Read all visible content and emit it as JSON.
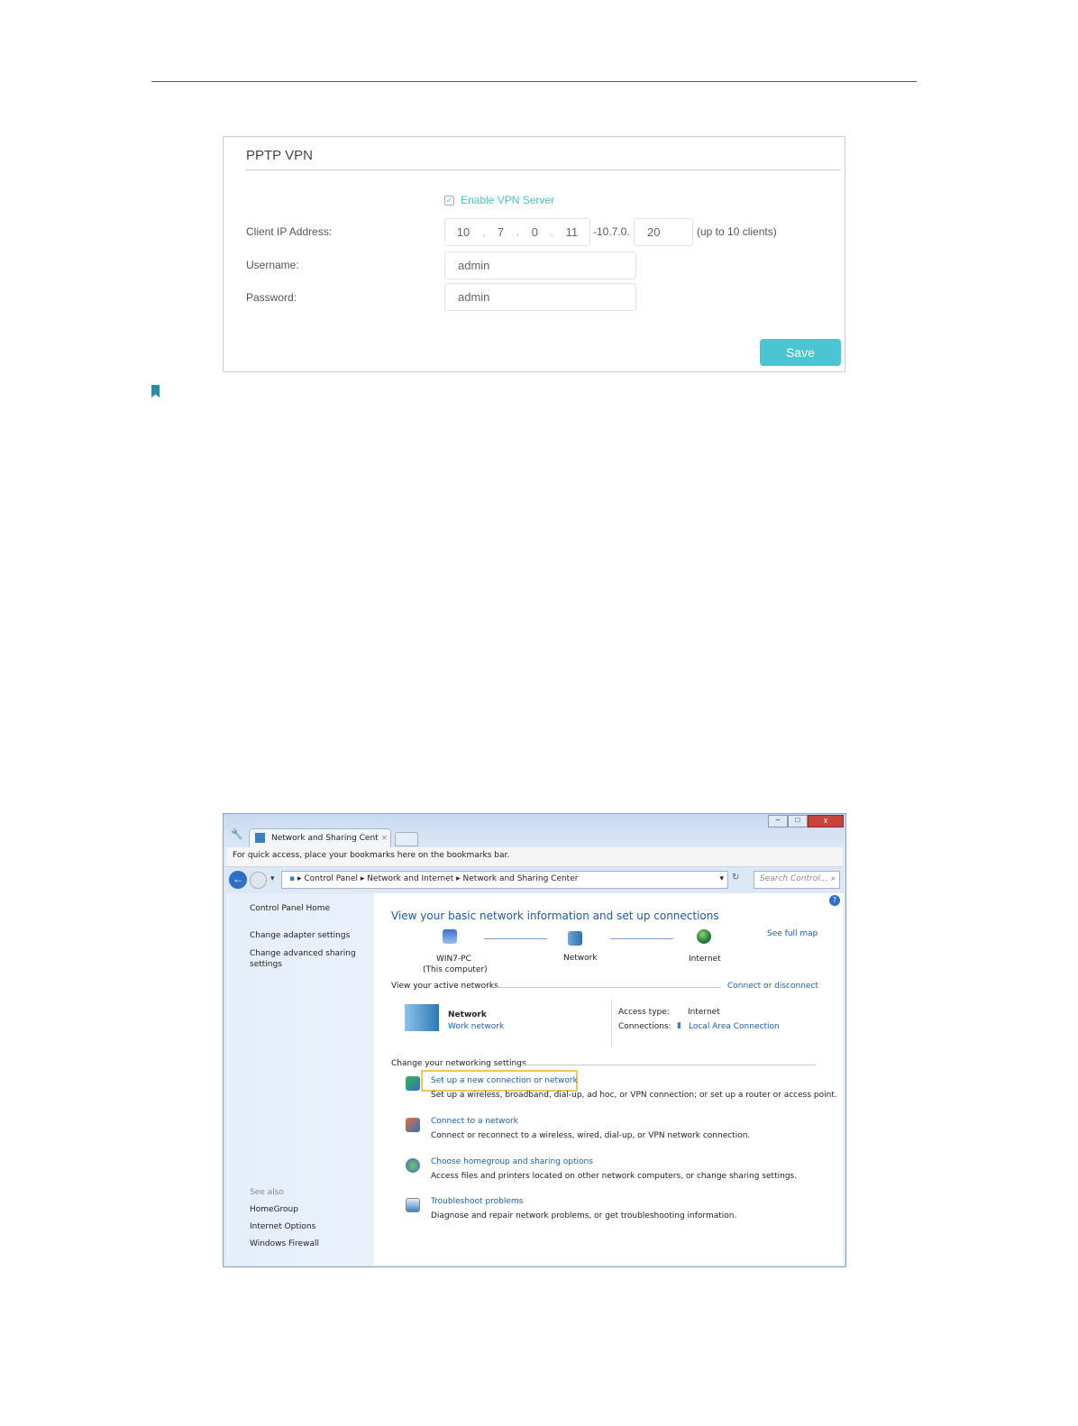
{
  "pptp": {
    "title": "PPTP VPN",
    "enable_label": "Enable VPN Server",
    "enabled": true,
    "client_ip_label": "Client IP Address:",
    "ip": [
      "10",
      "7",
      "0",
      "11"
    ],
    "range_prefix": "-10.7.0.",
    "range_end": "20",
    "range_note": "(up to 10 clients)",
    "username_label": "Username:",
    "username": "admin",
    "password_label": "Password:",
    "password": "admin",
    "save": "Save",
    "accent": "#4ac5d1"
  },
  "win": {
    "tab": "Network and Sharing Cent",
    "bookmarks_hint": "For quick access, place your bookmarks here on the bookmarks bar.",
    "breadcrumb": [
      "Control Panel",
      "Network and Internet",
      "Network and Sharing Center"
    ],
    "search_placeholder": "Search Control...",
    "sidebar": {
      "home": "Control Panel Home",
      "items": [
        "Change adapter settings",
        "Change advanced sharing settings"
      ],
      "see_also": "See also",
      "see_items": [
        "HomeGroup",
        "Internet Options",
        "Windows Firewall"
      ]
    },
    "heading": "View your basic network information and set up connections",
    "see_full_map": "See full map",
    "map": {
      "pc": "WIN7-PC",
      "pc_sub": "(This computer)",
      "network": "Network",
      "internet": "Internet"
    },
    "active_label": "View your active networks",
    "connect_disconnect": "Connect or disconnect",
    "net_name": "Network",
    "net_type": "Work network",
    "access_type_label": "Access type:",
    "access_type": "Internet",
    "connections_label": "Connections:",
    "connection": "Local Area Connection",
    "change_label": "Change your networking settings",
    "tasks": [
      {
        "title": "Set up a new connection or network",
        "desc": "Set up a wireless, broadband, dial-up, ad hoc, or VPN connection; or set up a router or access point."
      },
      {
        "title": "Connect to a network",
        "desc": "Connect or reconnect to a wireless, wired, dial-up, or VPN network connection."
      },
      {
        "title": "Choose homegroup and sharing options",
        "desc": "Access files and printers located on other network computers, or change sharing settings."
      },
      {
        "title": "Troubleshoot problems",
        "desc": "Diagnose and repair network problems, or get troubleshooting information."
      }
    ]
  }
}
